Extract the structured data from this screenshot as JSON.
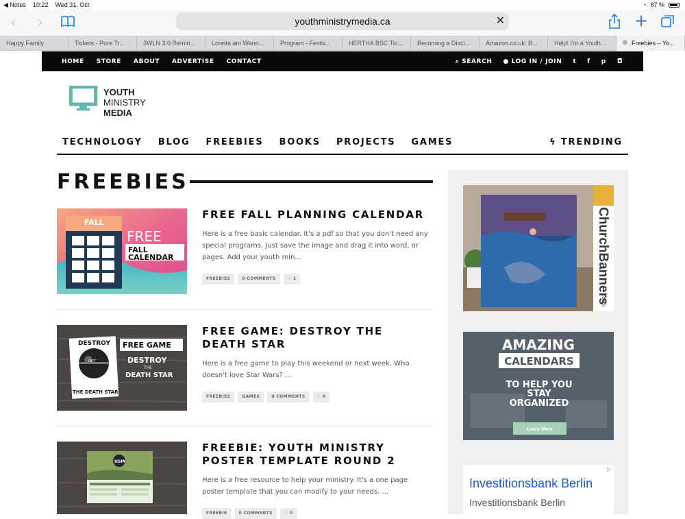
{
  "status": {
    "back_app": "◀ Notes",
    "time": "10:22",
    "date": "Wed 31. Oct",
    "battery": "87 %"
  },
  "browser": {
    "url": "youthministrymedia.ca",
    "tabs": [
      {
        "label": "Happy Family"
      },
      {
        "label": "Tickets - Pure Tr..."
      },
      {
        "label": "3WLN 3.0 Remin..."
      },
      {
        "label": "Loretta am Wann..."
      },
      {
        "label": "Program - Festiv..."
      },
      {
        "label": "HERTHA BSC Tic..."
      },
      {
        "label": "Becoming a Disci..."
      },
      {
        "label": "Amazon.co.uk: B..."
      },
      {
        "label": "Help! I'm a Youth..."
      },
      {
        "label": "Freebies – Yo..."
      }
    ]
  },
  "sitenav": {
    "links": [
      "HOME",
      "STORE",
      "ABOUT",
      "ADVERTISE",
      "CONTACT"
    ],
    "search": "SEARCH",
    "login": "LOG IN / JOIN"
  },
  "logo": {
    "line1": "YOUTH",
    "line2": "MINISTRY",
    "line3": "MEDIA",
    "accent": "#5fb8aa"
  },
  "catnav": {
    "items": [
      "TECHNOLOGY",
      "BLOG",
      "FREEBIES",
      "BOOKS",
      "PROJECTS",
      "GAMES"
    ],
    "trending": "TRENDING"
  },
  "page": {
    "title": "FREEBIES"
  },
  "posts": [
    {
      "title": "FREE FALL PLANNING CALENDAR",
      "excerpt": "Here is a free basic calendar.  It's a pdf so that you don't need any special programs.  Just save the image and drag it into word, or pages. Add your youth min...",
      "tags": [
        "FREEBIES",
        "0 COMMENTS",
        "♡ 1"
      ],
      "thumb": {
        "label1": "FALL",
        "label2": "FREE",
        "label3": "FALL",
        "label4": "CALENDAR"
      }
    },
    {
      "title": "FREE GAME: DESTROY THE DEATH STAR",
      "excerpt": "Here is a free game to play this weekend or next week. Who doesn't love Star Wars? ...",
      "tags": [
        "FREEBIES",
        "GAMES",
        "0 COMMENTS",
        "♡ 0"
      ],
      "thumb": {
        "label1": "DESTROY",
        "label2": "OUT",
        "label3": "THE DEATH STAR",
        "label4": "FREE GAME",
        "label5": "DESTROY",
        "label6": "THE",
        "label7": "DEATH STAR"
      }
    },
    {
      "title": "FREEBIE: YOUTH MINISTRY POSTER TEMPLATE ROUND 2",
      "excerpt": "Here is a free resource to help your ministry. It's a one page poster template that you can modify to your needs. ...",
      "tags": [
        "FREEBIE",
        "0 COMMENTS",
        "♡ 0"
      ],
      "thumb": {
        "label1": "HSM"
      }
    }
  ],
  "sidebar": {
    "ad1": {
      "brand": "ChurchBanners",
      "domain": ".com"
    },
    "ad2": {
      "line1": "AMAZING",
      "line2": "CALENDARS",
      "line3": "TO HELP YOU",
      "line4": "STAY",
      "line5": "ORGANIZED",
      "button": "Learn More"
    },
    "ad3": {
      "title": "Investitionsbank Berlin",
      "subtitle": "Investitionsbank Berlin"
    }
  }
}
